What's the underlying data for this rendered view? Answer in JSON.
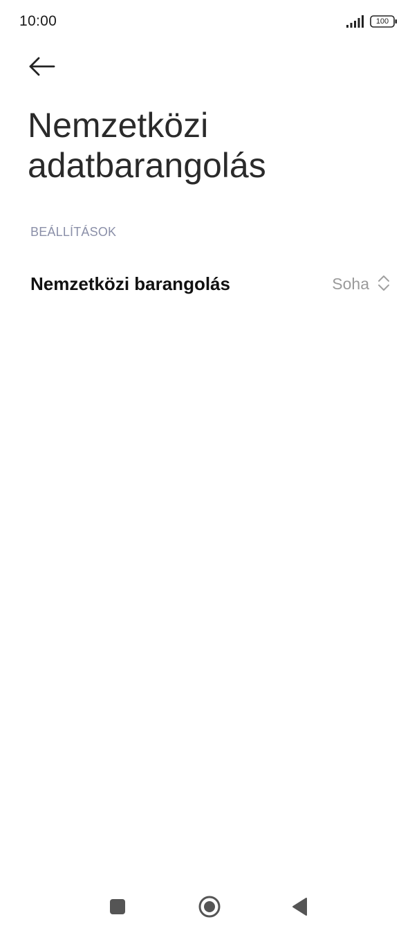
{
  "status_bar": {
    "time": "10:00",
    "battery": "100",
    "icons": [
      "signal-icon",
      "battery-icon"
    ]
  },
  "header": {
    "back_icon": "arrow-left-icon",
    "title_line1": "Nemzetközi",
    "title_line2": "adatbarangolás"
  },
  "section": {
    "header": "BEÁLLÍTÁSOK",
    "items": [
      {
        "label": "Nemzetközi barangolás",
        "value": "Soha",
        "icon": "up-down-chevron-icon"
      }
    ]
  },
  "nav_bar": {
    "icons": [
      "recents-square-icon",
      "home-circle-icon",
      "back-triangle-icon"
    ]
  },
  "colors": {
    "background": "#ffffff",
    "title": "#2a2a2a",
    "section_header": "#8a8fa8",
    "value": "#9a9a9a",
    "nav_icons": "#555555"
  }
}
